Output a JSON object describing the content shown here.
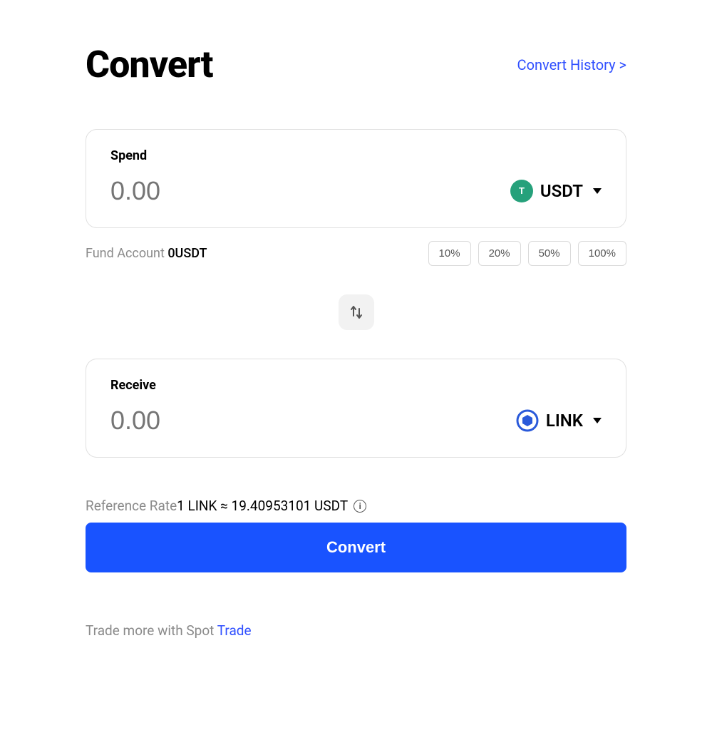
{
  "header": {
    "title": "Convert",
    "history_link": "Convert History >"
  },
  "spend": {
    "label": "Spend",
    "placeholder": "0.00",
    "coin": "USDT",
    "icon_letter": "T"
  },
  "fund": {
    "label": "Fund Account ",
    "value": "0USDT"
  },
  "percentages": [
    "10%",
    "20%",
    "50%",
    "100%"
  ],
  "receive": {
    "label": "Receive",
    "placeholder": "0.00",
    "coin": "LINK"
  },
  "rate": {
    "label": "Reference Rate",
    "value": "1 LINK ≈ 19.40953101 USDT"
  },
  "convert_button": "Convert",
  "footer": {
    "text": "Trade more with Spot ",
    "link_text": "Trade"
  }
}
